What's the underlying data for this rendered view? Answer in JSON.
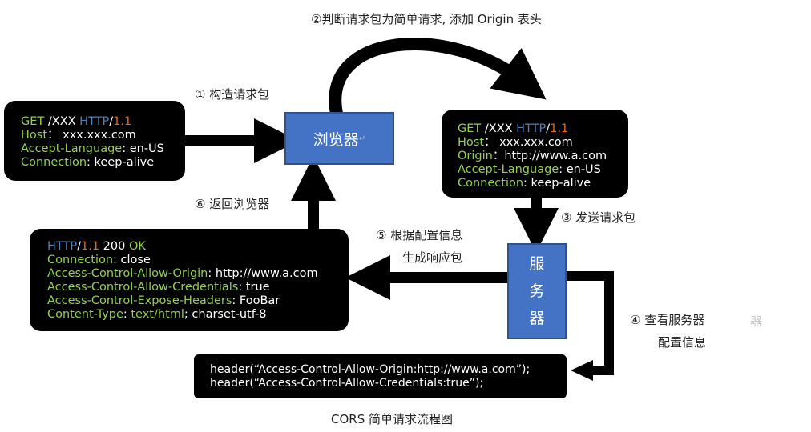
{
  "steps": {
    "s1": "① 构造请求包",
    "s2": "②判断请求包为简单请求, 添加 Origin 表头",
    "s3": "③ 发送请求包",
    "s4a": "④ 查看服务器",
    "s4b": "配置信息",
    "s5a": "⑤ 根据配置信息",
    "s5b": "生成响应包",
    "s6": "⑥ 返回浏览器"
  },
  "nodes": {
    "browser": "浏览器",
    "server": [
      "服",
      "务",
      "器"
    ],
    "return_mark": "↵",
    "ghost": "器"
  },
  "request1": {
    "line1": {
      "method": "GET",
      "path": " /XXX ",
      "proto": "HTTP",
      "sep": "/",
      "ver": "1.1"
    },
    "host_key": "Host",
    "host_sep": "： ",
    "host_val": "xxx.xxx.com",
    "lang_key": "Accept-Language",
    "lang_sep": ": ",
    "lang_val": "en-US",
    "conn_key": "Connection",
    "conn_sep": ": ",
    "conn_val": "keep-alive"
  },
  "request2": {
    "line1": {
      "method": "GET",
      "path": " /XXX ",
      "proto": "HTTP",
      "sep": "/",
      "ver": "1.1"
    },
    "host_key": "Host",
    "host_sep": "： ",
    "host_val": "xxx.xxx.com",
    "origin_key": "Origin",
    "origin_sep": "：",
    "origin_val": "http://www.a.com",
    "lang_key": "Accept-Language",
    "lang_sep": ": ",
    "lang_val": "en-US",
    "conn_key": "Connection",
    "conn_sep": ": ",
    "conn_val": "keep-alive"
  },
  "response": {
    "proto": "HTTP",
    "sep": "/",
    "ver": "1.1",
    "code": " 200 ",
    "ok": "OK",
    "conn_key": "Connection",
    "conn_sep": ": ",
    "conn_val": "close",
    "h1_key": "Access-Control-Allow-Origin",
    "h1_sep": ": ",
    "h1_val": "http://www.a.com",
    "h2_key": "Access-Control-Allow-Credentials",
    "h2_sep": ": ",
    "h2_val": "true",
    "h3_key": "Access-Control-Expose-Headers",
    "h3_sep": ": ",
    "h3_val": "FooBar",
    "h4_key": "Content-Type",
    "h4_sep": ": ",
    "h4_val": "text/html",
    "h4_rest": "; charset-utf-8"
  },
  "config": {
    "line1": "header(“Access-Control-Allow-Origin:http://www.a.com”);",
    "line2": "header(“Access-Control-Allow-Credentials:true”);"
  },
  "caption": "CORS 简单请求流程图",
  "colors": {
    "node": "#4472c4",
    "key": "#92d050",
    "proto": "#4f81bd",
    "ver": "#e36c09"
  }
}
